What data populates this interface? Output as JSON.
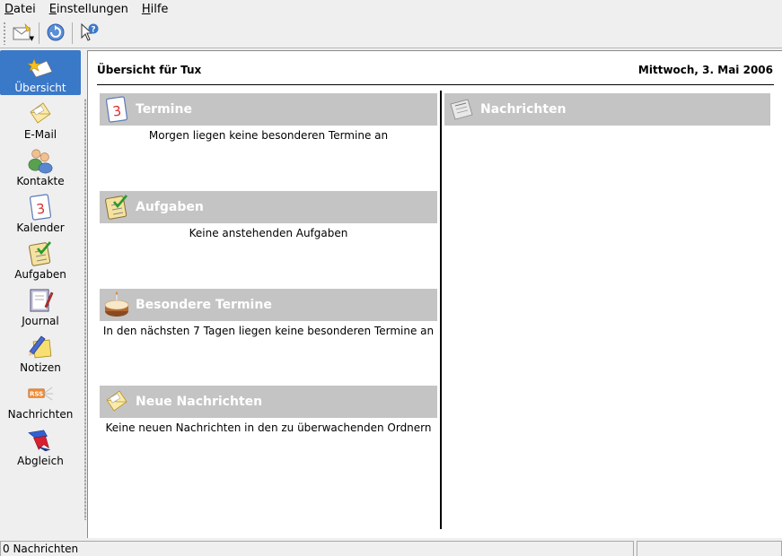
{
  "menubar": {
    "items": [
      {
        "mnemonic": "D",
        "rest": "atei"
      },
      {
        "mnemonic": "E",
        "rest": "instellungen"
      },
      {
        "mnemonic": "H",
        "rest": "ilfe"
      }
    ]
  },
  "toolbar": {
    "buttons": [
      "new-mail-icon",
      "sync-icon",
      "whats-this-help-icon"
    ]
  },
  "sidebar": {
    "items": [
      {
        "label": "Übersicht",
        "icon": "summary-icon",
        "active": true
      },
      {
        "label": "E-Mail",
        "icon": "mail-icon",
        "active": false
      },
      {
        "label": "Kontakte",
        "icon": "contacts-icon",
        "active": false
      },
      {
        "label": "Kalender",
        "icon": "calendar-icon",
        "active": false
      },
      {
        "label": "Aufgaben",
        "icon": "todo-icon",
        "active": false
      },
      {
        "label": "Journal",
        "icon": "journal-icon",
        "active": false
      },
      {
        "label": "Notizen",
        "icon": "notes-icon",
        "active": false
      },
      {
        "label": "Nachrichten",
        "icon": "rss-icon",
        "active": false
      },
      {
        "label": "Abgleich",
        "icon": "sync-icon",
        "active": false
      }
    ]
  },
  "main": {
    "title": "Übersicht für Tux",
    "date": "Mittwoch, 3. Mai 2006",
    "left_sections": [
      {
        "title": "Termine",
        "text": "Morgen liegen keine besonderen Termine an",
        "icon": "calendar-icon"
      },
      {
        "title": "Aufgaben",
        "text": "Keine anstehenden Aufgaben",
        "icon": "todo-icon"
      },
      {
        "title": "Besondere Termine",
        "text": "In den nächsten 7 Tagen liegen keine besonderen Termine an",
        "icon": "birthday-cake-icon"
      },
      {
        "title": "Neue Nachrichten",
        "text": "Keine neuen Nachrichten in den zu überwachenden Ordnern",
        "icon": "mail-icon"
      }
    ],
    "right_sections": [
      {
        "title": "Nachrichten",
        "icon": "newspaper-icon"
      }
    ]
  },
  "status": {
    "text": "0 Nachrichten"
  },
  "colors": {
    "accent": "#3a78c8",
    "section_bar": "#c4c4c4",
    "window_bg": "#efefef"
  }
}
